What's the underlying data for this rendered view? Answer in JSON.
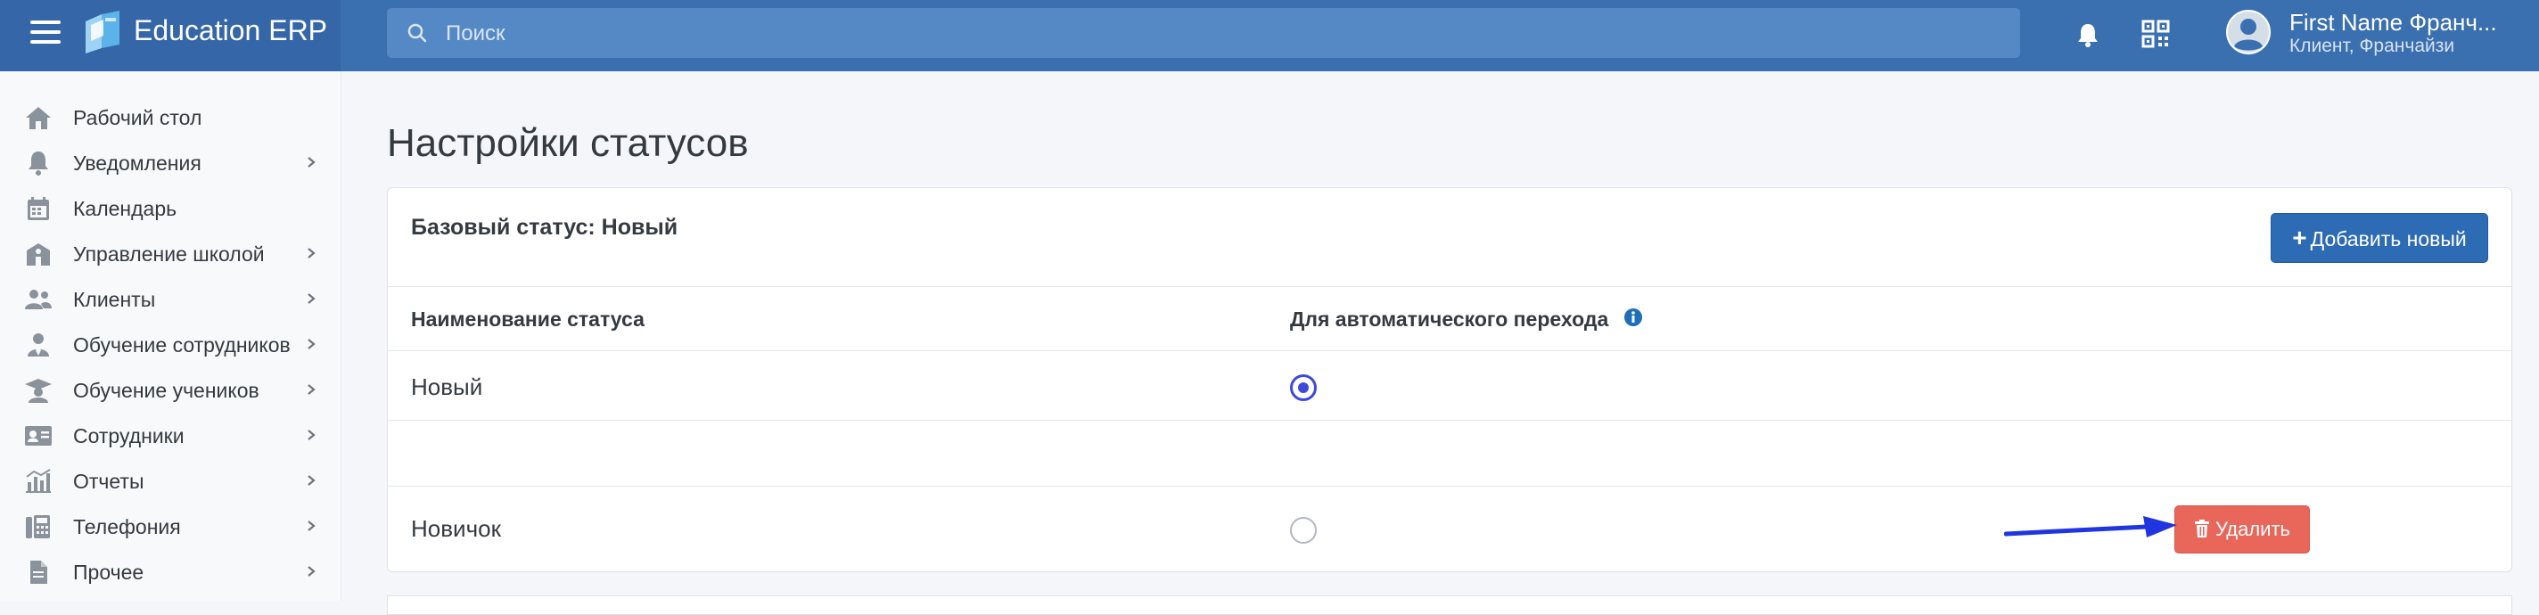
{
  "app": {
    "brand_name": "Education ERP"
  },
  "search": {
    "placeholder": "Поиск"
  },
  "user": {
    "name": "First Name Франч...",
    "role": "Клиент, Франчайзи"
  },
  "sidebar": {
    "items": [
      {
        "label": "Рабочий стол",
        "icon": "home-icon",
        "has_submenu": false
      },
      {
        "label": "Уведомления",
        "icon": "bell-icon",
        "has_submenu": true
      },
      {
        "label": "Календарь",
        "icon": "calendar-icon",
        "has_submenu": false
      },
      {
        "label": "Управление школой",
        "icon": "school-icon",
        "has_submenu": true
      },
      {
        "label": "Клиенты",
        "icon": "users-icon",
        "has_submenu": true
      },
      {
        "label": "Обучение сотрудников",
        "icon": "user-tie-icon",
        "has_submenu": true
      },
      {
        "label": "Обучение учеников",
        "icon": "graduation-icon",
        "has_submenu": true
      },
      {
        "label": "Сотрудники",
        "icon": "id-card-icon",
        "has_submenu": true
      },
      {
        "label": "Отчеты",
        "icon": "chart-icon",
        "has_submenu": true
      },
      {
        "label": "Телефония",
        "icon": "fax-icon",
        "has_submenu": true
      },
      {
        "label": "Прочее",
        "icon": "file-icon",
        "has_submenu": true
      }
    ]
  },
  "page": {
    "title": "Настройки статусов"
  },
  "card": {
    "base_status": "Базовый статус: Новый",
    "add_button": "Добавить новый",
    "columns": {
      "name": "Наименование статуса",
      "auto": "Для автоматического перехода"
    },
    "rows": [
      {
        "name": "Новый",
        "auto_selected": true
      },
      {
        "name": "Новичок",
        "auto_selected": false,
        "delete_label": "Удалить"
      }
    ]
  },
  "colors": {
    "topbar": "#3a6fb0",
    "primary_button": "#2d6bb5",
    "danger_button": "#e8665a",
    "radio_selected": "#3f49d9",
    "annotation_arrow": "#1f35e0"
  }
}
